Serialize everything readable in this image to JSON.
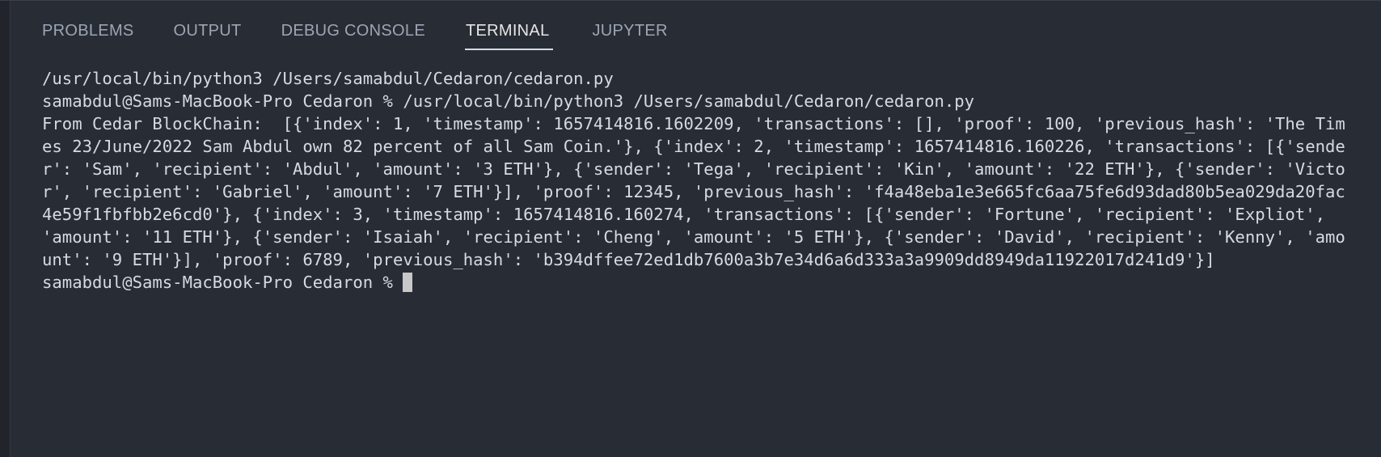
{
  "tabs": [
    {
      "label": "PROBLEMS"
    },
    {
      "label": "OUTPUT"
    },
    {
      "label": "DEBUG CONSOLE"
    },
    {
      "label": "TERMINAL"
    },
    {
      "label": "JUPYTER"
    }
  ],
  "terminal": {
    "line1": "/usr/local/bin/python3 /Users/samabdul/Cedaron/cedaron.py",
    "line2": "samabdul@Sams-MacBook-Pro Cedaron % /usr/local/bin/python3 /Users/samabdul/Cedaron/cedaron.py",
    "output": "From Cedar BlockChain:  [{'index': 1, 'timestamp': 1657414816.1602209, 'transactions': [], 'proof': 100, 'previous_hash': 'The Times 23/June/2022 Sam Abdul own 82 percent of all Sam Coin.'}, {'index': 2, 'timestamp': 1657414816.160226, 'transactions': [{'sender': 'Sam', 'recipient': 'Abdul', 'amount': '3 ETH'}, {'sender': 'Tega', 'recipient': 'Kin', 'amount': '22 ETH'}, {'sender': 'Victor', 'recipient': 'Gabriel', 'amount': '7 ETH'}], 'proof': 12345, 'previous_hash': 'f4a48eba1e3e665fc6aa75fe6d93dad80b5ea029da20fac4e59f1fbfbb2e6cd0'}, {'index': 3, 'timestamp': 1657414816.160274, 'transactions': [{'sender': 'Fortune', 'recipient': 'Expliot', 'amount': '11 ETH'}, {'sender': 'Isaiah', 'recipient': 'Cheng', 'amount': '5 ETH'}, {'sender': 'David', 'recipient': 'Kenny', 'amount': '9 ETH'}], 'proof': 6789, 'previous_hash': 'b394dffee72ed1db7600a3b7e34d6a6d333a3a9909dd8949da11922017d241d9'}]",
    "prompt": "samabdul@Sams-MacBook-Pro Cedaron % "
  }
}
